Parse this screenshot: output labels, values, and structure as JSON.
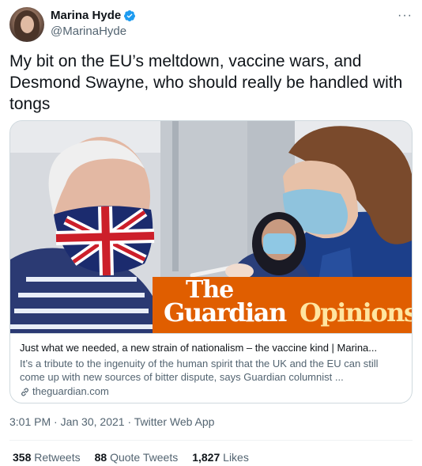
{
  "author": {
    "display_name": "Marina Hyde",
    "handle": "@MarinaHyde",
    "verified": true,
    "avatar_icon": "profile-photo"
  },
  "more_menu": "···",
  "tweet": {
    "text": "My bit on the EU’s meltdown, vaccine wars, and Desmond Swayne, who should really be handled with tongs"
  },
  "card": {
    "image_overlay": {
      "the": "The",
      "guardian": "Guardian",
      "opinions": "Opinions"
    },
    "title": "Just what we needed, a new strain of nationalism – the vaccine kind | Marina...",
    "description": "It’s a tribute to the ingenuity of the human spirit that the UK and the EU can still come up with new sources of bitter dispute, says Guardian columnist ...",
    "domain": "theguardian.com",
    "link_icon": "link-icon"
  },
  "meta": {
    "time": "3:01 PM",
    "date": "Jan 30, 2021",
    "client": "Twitter Web App",
    "separator": "·"
  },
  "stats": {
    "retweets_count": "358",
    "retweets_label": "Retweets",
    "quotes_count": "88",
    "quotes_label": "Quote Tweets",
    "likes_count": "1,827",
    "likes_label": "Likes"
  },
  "colors": {
    "text_primary": "#0f1419",
    "text_secondary": "#536471",
    "verified_blue": "#1d9bf0",
    "guardian_orange": "#e05e00",
    "border": "#cfd9de"
  }
}
